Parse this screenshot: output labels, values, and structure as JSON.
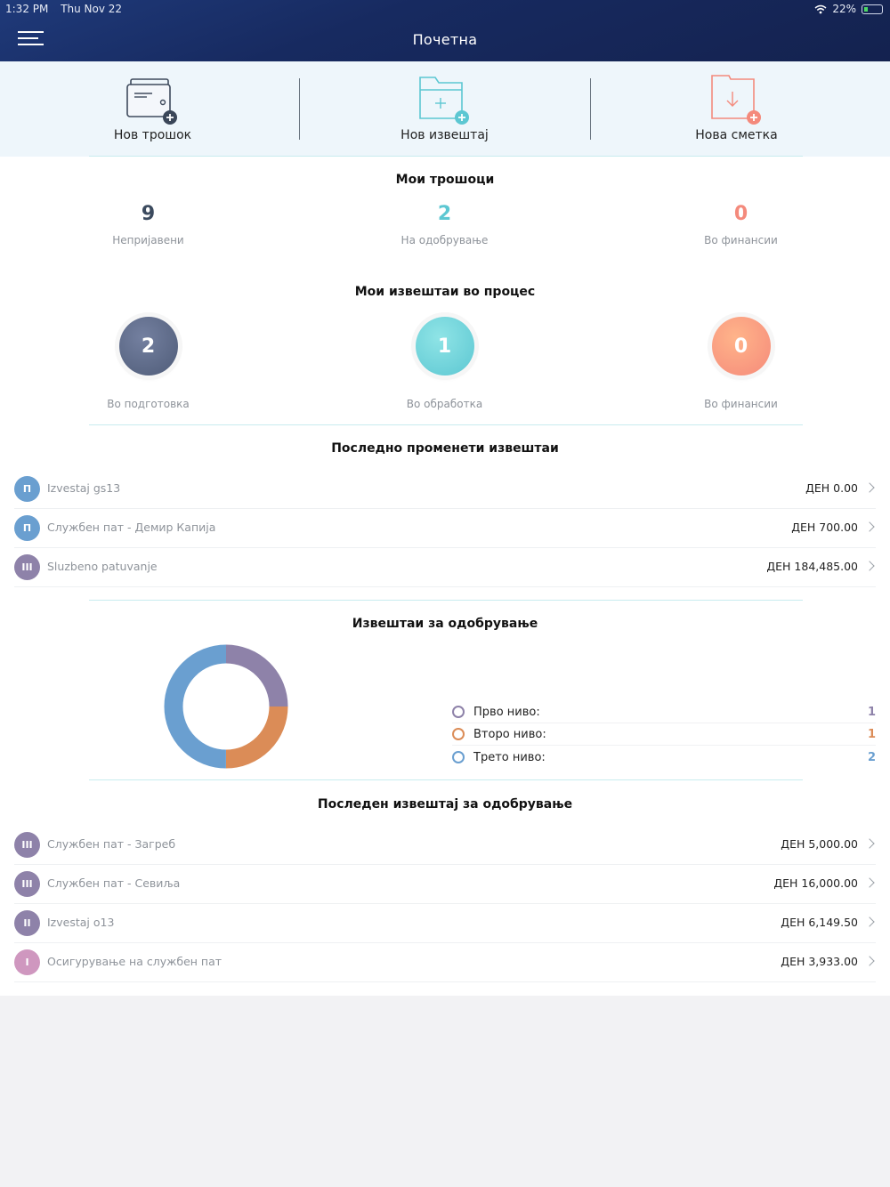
{
  "status_bar": {
    "time": "1:32 PM",
    "date": "Thu Nov 22",
    "battery": "22%"
  },
  "header": {
    "title": "Почетна"
  },
  "actions": [
    {
      "label": "Нов трошок"
    },
    {
      "label": "Нов извештај"
    },
    {
      "label": "Нова сметка"
    }
  ],
  "my_expenses": {
    "title": "Мои трошоци",
    "stats": [
      {
        "value": "9",
        "label": "Непријавени",
        "color": "#3b4a5e"
      },
      {
        "value": "2",
        "label": "На одобрување",
        "color": "#5cc7d2"
      },
      {
        "value": "0",
        "label": "Во финансии",
        "color": "#f48a7c"
      }
    ]
  },
  "my_reports": {
    "title": "Мои извештаи во процес",
    "stats": [
      {
        "value": "2",
        "label": "Во подготовка",
        "color": "#5a6782"
      },
      {
        "value": "1",
        "label": "Во обработка",
        "color": "#6ed3d8"
      },
      {
        "value": "0",
        "label": "Во финансии",
        "color": "#f8937a"
      }
    ]
  },
  "recent_reports": {
    "title": "Последно променети извештаи",
    "items": [
      {
        "badge": "П",
        "badge_color": "#6a9fd0",
        "name": "Izvestaj gs13",
        "amount": "ДЕН 0.00"
      },
      {
        "badge": "П",
        "badge_color": "#6a9fd0",
        "name": "Службен пат - Демир Капија",
        "amount": "ДЕН 700.00"
      },
      {
        "badge": "III",
        "badge_color": "#8e82a9",
        "name": "Sluzbeno patuvanje",
        "amount": "ДЕН 184,485.00"
      }
    ]
  },
  "approval_reports": {
    "title": "Извештаи за одобрување",
    "chart_data": {
      "type": "pie",
      "categories": [
        "Прво ниво:",
        "Второ ниво:",
        "Трето ниво:"
      ],
      "values": [
        1,
        1,
        2
      ],
      "colors": [
        "#8e82a9",
        "#db8c57",
        "#6a9fd0"
      ]
    },
    "legend": [
      {
        "label": "Прво ниво:",
        "value": "1",
        "color": "#8e82a9"
      },
      {
        "label": "Второ ниво:",
        "value": "1",
        "color": "#db8c57"
      },
      {
        "label": "Трето ниво:",
        "value": "2",
        "color": "#6a9fd0"
      }
    ]
  },
  "latest_approval": {
    "title": "Последен извештај за одобрување",
    "items": [
      {
        "badge": "III",
        "badge_color": "#8e82a9",
        "name": "Службен пат - Загреб",
        "amount": "ДЕН 5,000.00"
      },
      {
        "badge": "III",
        "badge_color": "#8e82a9",
        "name": "Службен пат - Севиља",
        "amount": "ДЕН 16,000.00"
      },
      {
        "badge": "II",
        "badge_color": "#8e82a9",
        "name": "Izvestaj o13",
        "amount": "ДЕН 6,149.50"
      },
      {
        "badge": "I",
        "badge_color": "#cf97bf",
        "name": "Осигурување на службен пат",
        "amount": "ДЕН 3,933.00"
      }
    ]
  }
}
